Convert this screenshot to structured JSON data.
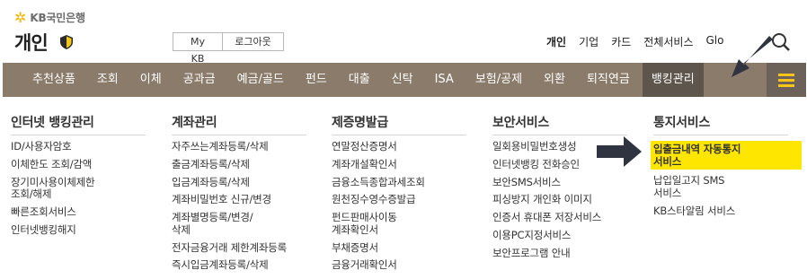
{
  "header": {
    "logo_brand": "KB국민은행",
    "logo_title": "개인",
    "mykb_label": "My KB",
    "logout_label": "로그아웃",
    "top_links": [
      "개인",
      "기업",
      "카드",
      "전체서비스",
      "Glo"
    ]
  },
  "nav": {
    "items": [
      "추천상품",
      "조회",
      "이체",
      "공과금",
      "예금/골드",
      "펀드",
      "대출",
      "신탁",
      "ISA",
      "보험/공제",
      "외환",
      "퇴직연금",
      "뱅킹관리"
    ],
    "active": "뱅킹관리"
  },
  "columns": [
    {
      "title": "인터넷 뱅킹관리",
      "items": [
        "ID/사용자암호",
        "이체한도 조회/감액",
        "장기미사용이체제한\n조회/해제",
        "빠른조회서비스",
        "인터넷뱅킹해지"
      ]
    },
    {
      "title": "계좌관리",
      "items": [
        "자주쓰는계좌등록/삭제",
        "출금계좌등록/삭제",
        "입금계좌등록/삭제",
        "계좌비밀번호 신규/변경",
        "계좌별명등록/변경/\n삭제",
        "전자금융거래 제한계좌등록",
        "즉시입금계좌등록/삭제"
      ]
    },
    {
      "title": "제증명발급",
      "items": [
        "연말정산증명서",
        "계좌개설확인서",
        "금융소득종합과세조회",
        "원천징수영수증발급",
        "펀드판매사이동\n계좌확인서",
        "부채증명서",
        "금융거래확인서"
      ]
    },
    {
      "title": "보안서비스",
      "items": [
        "일회용비밀번호생성",
        "인터넷뱅킹 전화승인",
        "보안SMS서비스",
        "피싱방지 개인화 이미지",
        "인증서 휴대폰 저장서비스",
        "이용PC지정서비스",
        "보안프로그램 안내"
      ]
    },
    {
      "title": "통지서비스",
      "items": [
        "입출금내역 자동통지\n서비스",
        "납입일고지 SMS\n서비스",
        "KB스타알림 서비스"
      ],
      "highlighted_index": 0
    }
  ],
  "colors": {
    "nav_bg": "#8b7b6b",
    "nav_active": "#5e554c",
    "highlight": "#ffe600",
    "accent": "#f5c518",
    "arrow": "#2f3440"
  },
  "icons": [
    "star-logo-icon",
    "shield-icon",
    "search-icon",
    "hamburger-menu-icon",
    "pointer-arrow-icon"
  ]
}
